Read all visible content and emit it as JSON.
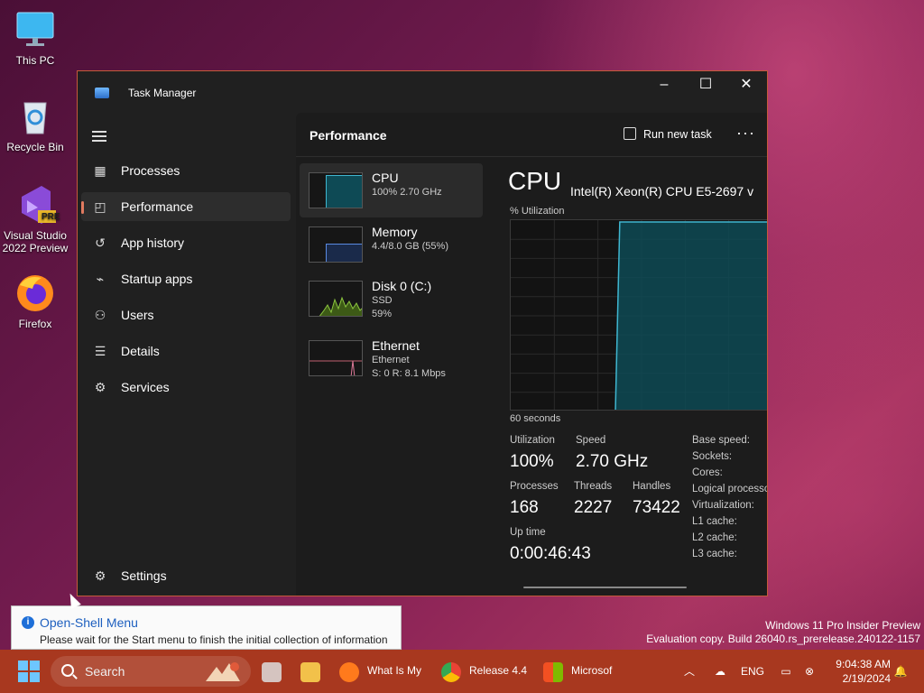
{
  "desktop": {
    "icons": [
      {
        "label": "This PC",
        "icon": "monitor-icon"
      },
      {
        "label": "Recycle Bin",
        "icon": "recycle-bin-icon"
      },
      {
        "label": "Visual Studio\n2022 Preview",
        "label_line1": "Visual Studio",
        "label_line2": "2022 Preview",
        "badge": "PRE",
        "icon": "visual-studio-icon"
      },
      {
        "label": "Firefox",
        "icon": "firefox-icon"
      }
    ]
  },
  "window": {
    "title": "Task Manager",
    "controls": {
      "minimize": "–",
      "maximize": "☐",
      "close": "✕"
    }
  },
  "nav": {
    "items": [
      {
        "label": "Processes",
        "icon": "processes-icon",
        "active": false
      },
      {
        "label": "Performance",
        "icon": "performance-icon",
        "active": true
      },
      {
        "label": "App history",
        "icon": "app-history-icon",
        "active": false
      },
      {
        "label": "Startup apps",
        "icon": "startup-apps-icon",
        "active": false
      },
      {
        "label": "Users",
        "icon": "users-icon",
        "active": false
      },
      {
        "label": "Details",
        "icon": "details-icon",
        "active": false
      },
      {
        "label": "Services",
        "icon": "services-icon",
        "active": false
      }
    ],
    "settings": "Settings"
  },
  "header": {
    "title": "Performance",
    "run_new_task": "Run new task",
    "more": "···"
  },
  "resources": [
    {
      "name": "CPU",
      "sub1": "100%  2.70 GHz",
      "sub2": "",
      "active": true
    },
    {
      "name": "Memory",
      "sub1": "4.4/8.0 GB (55%)",
      "sub2": "",
      "active": false
    },
    {
      "name": "Disk 0 (C:)",
      "sub1": "SSD",
      "sub2": "59%",
      "active": false
    },
    {
      "name": "Ethernet",
      "sub1": "Ethernet",
      "sub2": "S: 0  R: 8.1 Mbps",
      "active": false
    }
  ],
  "cpu": {
    "title": "CPU",
    "model": "Intel(R) Xeon(R) CPU E5-2697 v",
    "graph_label": "% Utilization",
    "time_label": "60 seconds",
    "stats": {
      "utilization_label": "Utilization",
      "utilization": "100%",
      "speed_label": "Speed",
      "speed": "2.70 GHz",
      "processes_label": "Processes",
      "processes": "168",
      "threads_label": "Threads",
      "threads": "2227",
      "handles_label": "Handles",
      "handles": "73422",
      "uptime_label": "Up time",
      "uptime": "0:00:46:43"
    },
    "right_labels": [
      "Base speed:",
      "Sockets:",
      "Cores:",
      "Logical processo",
      "Virtualization:",
      "L1 cache:",
      "L2 cache:",
      "L3 cache:"
    ]
  },
  "chart_data": {
    "type": "area",
    "title": "",
    "ylabel": "% Utilization",
    "xlabel": "60 seconds",
    "ylim": [
      0,
      100
    ],
    "x": [
      0,
      12,
      24,
      25,
      30,
      36,
      42,
      48,
      54,
      60
    ],
    "series": [
      {
        "values": [
          0,
          0,
          0,
          100,
          100,
          100,
          100,
          100,
          100,
          100
        ]
      }
    ]
  },
  "toast": {
    "title": "Open-Shell Menu",
    "message": "Please wait for the Start menu to finish the initial collection of information"
  },
  "watermark": {
    "line1": "Windows 11 Pro Insider Preview",
    "line2": "Evaluation copy. Build 26040.rs_prerelease.240122-1157"
  },
  "taskbar": {
    "search": "Search",
    "apps": [
      {
        "label": "What Is My",
        "icon": "firefox-icon"
      },
      {
        "label": "Release 4.4",
        "icon": "chrome-icon"
      },
      {
        "label": "Microsof",
        "icon": "store-icon"
      }
    ],
    "tray": {
      "language": "ENG",
      "time": "9:04:38 AM",
      "date": "2/19/2024"
    }
  },
  "colors": {
    "accent": "#e07a5f",
    "graph_fill": "#0e4a55",
    "graph_line": "#3fb6d0",
    "taskbar": "#a8381f"
  }
}
